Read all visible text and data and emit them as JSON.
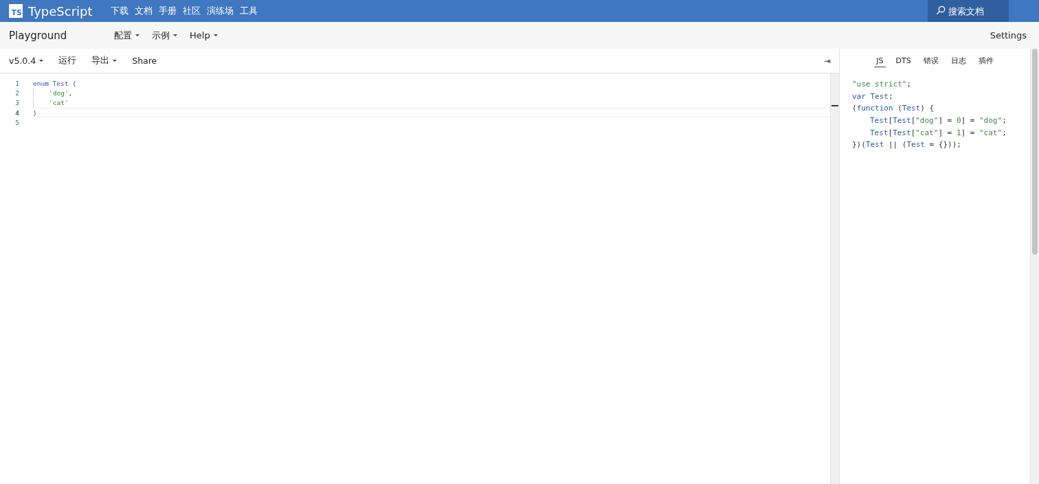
{
  "topnav": {
    "logo_badge": "TS",
    "brand": "TypeScript",
    "links": [
      "下载",
      "文档",
      "手册",
      "社区",
      "演练场",
      "工具"
    ],
    "search": {
      "placeholder": "搜索文档"
    }
  },
  "subnav": {
    "title": "Playground",
    "menus": [
      {
        "label": "配置",
        "dropdown": true
      },
      {
        "label": "示例",
        "dropdown": true
      },
      {
        "label": "Help",
        "dropdown": true
      }
    ],
    "settings": "Settings"
  },
  "toolbar": {
    "items": [
      {
        "label": "v5.0.4",
        "dropdown": true
      },
      {
        "label": "运行",
        "dropdown": false
      },
      {
        "label": "导出",
        "dropdown": true
      },
      {
        "label": "Share",
        "dropdown": false
      }
    ],
    "collapse": "⇥"
  },
  "editor": {
    "lines": [
      {
        "number": "1",
        "current": false,
        "indent": false,
        "tokens": [
          {
            "text": "enum",
            "kind": "keyword"
          },
          {
            "text": " Test {",
            "kind": "identifier"
          }
        ]
      },
      {
        "number": "2",
        "current": false,
        "indent": true,
        "tokens": [
          {
            "text": "'dog'",
            "kind": "string"
          },
          {
            "text": ",",
            "kind": "punctuation"
          }
        ]
      },
      {
        "number": "3",
        "current": false,
        "indent": true,
        "tokens": [
          {
            "text": "'cat'",
            "kind": "string"
          }
        ]
      },
      {
        "number": "4",
        "current": true,
        "indent": false,
        "tokens": [
          {
            "text": "}",
            "kind": "identifier"
          }
        ]
      },
      {
        "number": "5",
        "current": false,
        "indent": false
      }
    ]
  },
  "output": {
    "tabs": [
      {
        "label": "JS",
        "selected": true
      },
      {
        "label": "DTS",
        "selected": false
      },
      {
        "label": "错误",
        "selected": false
      },
      {
        "label": "日志",
        "selected": false
      },
      {
        "label": "插件",
        "selected": false
      }
    ],
    "lines": [
      {
        "indent": false,
        "tokens": [
          {
            "text": "\"use strict\"",
            "kind": "string"
          },
          {
            "text": ";",
            "kind": "punctuation"
          }
        ]
      },
      {
        "indent": false,
        "tokens": [
          {
            "text": "var",
            "kind": "keyword"
          },
          {
            "text": " Test",
            "kind": "identifier"
          },
          {
            "text": ";",
            "kind": "punctuation"
          }
        ]
      },
      {
        "indent": false,
        "tokens": [
          {
            "text": "(",
            "kind": "punctuation"
          },
          {
            "text": "function",
            "kind": "keyword"
          },
          {
            "text": " (",
            "kind": "punctuation"
          },
          {
            "text": "Test",
            "kind": "identifier"
          },
          {
            "text": ") {",
            "kind": "punctuation"
          }
        ]
      },
      {
        "indent": true,
        "tokens": [
          {
            "text": "Test",
            "kind": "identifier"
          },
          {
            "text": "[",
            "kind": "punctuation"
          },
          {
            "text": "Test",
            "kind": "identifier"
          },
          {
            "text": "[",
            "kind": "punctuation"
          },
          {
            "text": "\"dog\"",
            "kind": "string"
          },
          {
            "text": "] = ",
            "kind": "punctuation"
          },
          {
            "text": "0",
            "kind": "number"
          },
          {
            "text": "] = ",
            "kind": "punctuation"
          },
          {
            "text": "\"dog\"",
            "kind": "string"
          },
          {
            "text": ";",
            "kind": "punctuation"
          }
        ]
      },
      {
        "indent": true,
        "tokens": [
          {
            "text": "Test",
            "kind": "identifier"
          },
          {
            "text": "[",
            "kind": "punctuation"
          },
          {
            "text": "Test",
            "kind": "identifier"
          },
          {
            "text": "[",
            "kind": "punctuation"
          },
          {
            "text": "\"cat\"",
            "kind": "string"
          },
          {
            "text": "] = ",
            "kind": "punctuation"
          },
          {
            "text": "1",
            "kind": "number"
          },
          {
            "text": "] = ",
            "kind": "punctuation"
          },
          {
            "text": "\"cat\"",
            "kind": "string"
          },
          {
            "text": ";",
            "kind": "punctuation"
          }
        ]
      },
      {
        "indent": false,
        "tokens": [
          {
            "text": "})(",
            "kind": "punctuation"
          },
          {
            "text": "Test",
            "kind": "identifier"
          },
          {
            "text": " || (",
            "kind": "punctuation"
          },
          {
            "text": "Test",
            "kind": "identifier"
          },
          {
            "text": " = {}));",
            "kind": "punctuation"
          }
        ]
      }
    ]
  }
}
